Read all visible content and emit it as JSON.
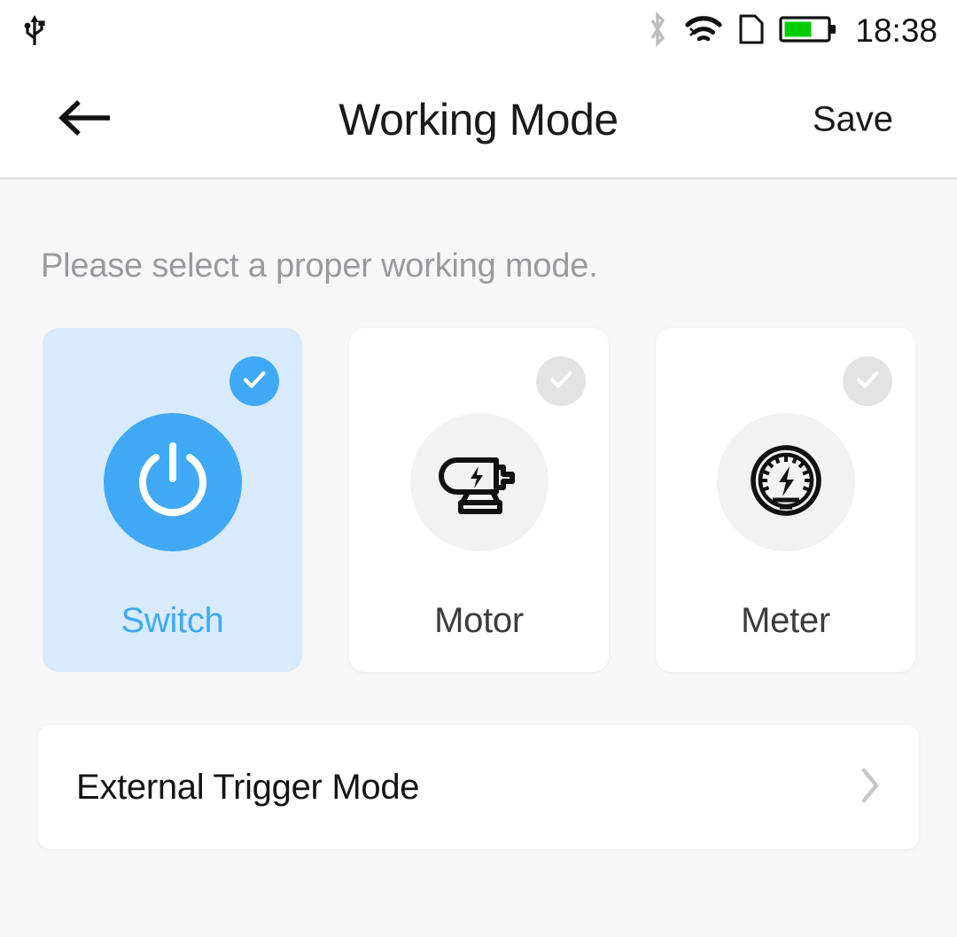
{
  "statusbar": {
    "time": "18:38",
    "icons": {
      "usb": "usb-icon",
      "bluetooth": "bluetooth-icon",
      "wifi": "wifi-icon",
      "sim": "sim-card-icon",
      "battery": "battery-icon"
    },
    "battery_level_percent": 62,
    "battery_fill_color": "#00cc00",
    "bluetooth_color": "#bcbcbc"
  },
  "header": {
    "back_label": "back-arrow",
    "title": "Working Mode",
    "save_label": "Save"
  },
  "main": {
    "hint": "Please select a proper working mode.",
    "modes": [
      {
        "label": "Switch",
        "icon": "power-icon",
        "selected": true
      },
      {
        "label": "Motor",
        "icon": "motor-icon",
        "selected": false
      },
      {
        "label": "Meter",
        "icon": "speedometer-icon",
        "selected": false
      }
    ],
    "trigger_row": {
      "label": "External Trigger Mode",
      "chevron": "chevron-right-icon"
    }
  },
  "colors": {
    "accent": "#40a9f5",
    "accent_bg": "#d9eafd",
    "page_bg": "#f7f7f8",
    "card_bg": "#ffffff",
    "muted_text": "#9a9a9e",
    "icon_circle_bg": "#f2f2f3",
    "badge_inactive": "#e3e3e4"
  }
}
